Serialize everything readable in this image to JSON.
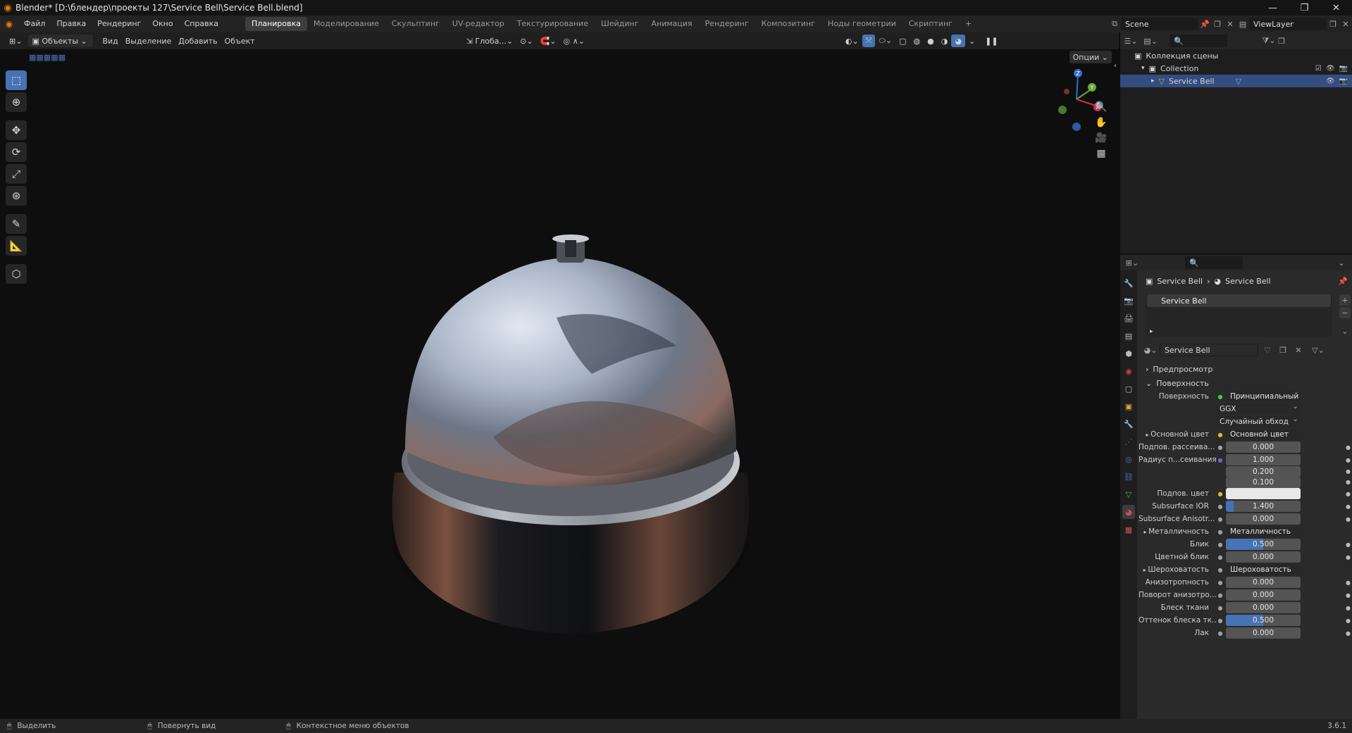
{
  "window": {
    "title": "Blender* [D:\\блендер\\проекты 127\\Service Bell\\Service Bell.blend]",
    "controls": [
      "—",
      "❐",
      "✕"
    ]
  },
  "menu": [
    "Файл",
    "Правка",
    "Рендеринг",
    "Окно",
    "Справка"
  ],
  "workspaces": [
    {
      "label": "Планировка",
      "active": true
    },
    {
      "label": "Моделирование",
      "active": false
    },
    {
      "label": "Скульптинг",
      "active": false
    },
    {
      "label": "UV-редактор",
      "active": false
    },
    {
      "label": "Текстурирование",
      "active": false
    },
    {
      "label": "Шейдинг",
      "active": false
    },
    {
      "label": "Анимация",
      "active": false
    },
    {
      "label": "Рендеринг",
      "active": false
    },
    {
      "label": "Композитинг",
      "active": false
    },
    {
      "label": "Ноды геометрии",
      "active": false
    },
    {
      "label": "Скриптинг",
      "active": false
    }
  ],
  "add_workspace": "+",
  "scene": {
    "name": "Scene",
    "view_layer": "ViewLayer"
  },
  "viewport": {
    "mode": "Объекты",
    "menus": [
      "Вид",
      "Выделение",
      "Добавить",
      "Объект"
    ],
    "orientation": "Глоба...",
    "options_label": "Опции"
  },
  "outliner": {
    "root": "Коллекция сцены",
    "collection": "Collection",
    "object": "Service Bell"
  },
  "properties": {
    "breadcrumb_object": "Service Bell",
    "breadcrumb_material": "Service Bell",
    "slot": "Service Bell",
    "material_name": "Service Bell",
    "panels": {
      "preview": "Предпросмотр",
      "surface": "Поверхность"
    },
    "rows": [
      {
        "label": "Поверхность",
        "type": "link",
        "value": "Принципиальный BSDF",
        "socket": "green"
      },
      {
        "label": "",
        "type": "dropdown",
        "value": "GGX"
      },
      {
        "label": "",
        "type": "dropdown",
        "value": "Случайный обход"
      },
      {
        "label": "Основной цвет",
        "type": "link",
        "value": "Основной цвет",
        "socket": "yellow",
        "expand": true
      },
      {
        "label": "Подпов. рассеива...",
        "type": "num",
        "value": "0.000",
        "socket": "grey"
      },
      {
        "label": "Радиус п...сеивания",
        "type": "num",
        "value": "1.000",
        "socket": "purple"
      },
      {
        "label": "",
        "type": "num",
        "value": "0.200"
      },
      {
        "label": "",
        "type": "num",
        "value": "0.100"
      },
      {
        "label": "Подпов. цвет",
        "type": "color",
        "value": "#e8e8e8",
        "socket": "yellow"
      },
      {
        "label": "Subsurface IOR",
        "type": "num",
        "value": "1.400",
        "socket": "grey",
        "fill": 0.1
      },
      {
        "label": "Subsurface Anisotr...",
        "type": "num",
        "value": "0.000",
        "socket": "grey"
      },
      {
        "label": "Металличность",
        "type": "link",
        "value": "Металличность",
        "socket": "grey",
        "expand": true
      },
      {
        "label": "Блик",
        "type": "num",
        "value": "0.500",
        "socket": "grey",
        "fill": 0.5
      },
      {
        "label": "Цветной блик",
        "type": "num",
        "value": "0.000",
        "socket": "grey"
      },
      {
        "label": "Шероховатость",
        "type": "link",
        "value": "Шероховатость",
        "socket": "grey",
        "expand": true
      },
      {
        "label": "Анизотропность",
        "type": "num",
        "value": "0.000",
        "socket": "grey"
      },
      {
        "label": "Поворот анизотро...",
        "type": "num",
        "value": "0.000",
        "socket": "grey"
      },
      {
        "label": "Блеск ткани",
        "type": "num",
        "value": "0.000",
        "socket": "grey"
      },
      {
        "label": "Оттенок блеска тк...",
        "type": "num",
        "value": "0.500",
        "socket": "grey",
        "fill": 0.5
      },
      {
        "label": "Лак",
        "type": "num",
        "value": "0.000",
        "socket": "grey"
      }
    ]
  },
  "statusbar": {
    "select": "Выделить",
    "rotate": "Повернуть вид",
    "context": "Контекстное меню объектов",
    "version": "3.6.1"
  },
  "colors": {
    "accent": "#4772b3",
    "selection": "#334d80",
    "orange": "#e87d0d"
  }
}
